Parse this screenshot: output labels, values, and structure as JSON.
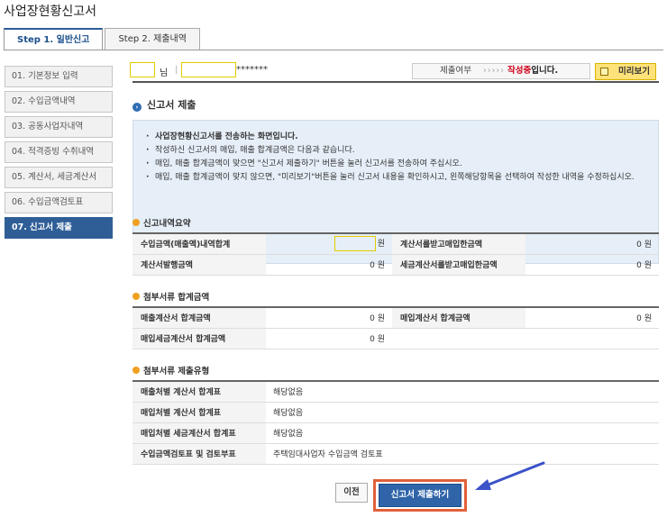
{
  "page": {
    "title": "사업장현황신고서"
  },
  "tabs": [
    {
      "label": "Step 1. 일반신고"
    },
    {
      "label": "Step 2. 제출내역"
    }
  ],
  "sidebar": {
    "items": [
      {
        "num": "01.",
        "label": "기본정보 입력"
      },
      {
        "num": "02.",
        "label": "수입금액내역"
      },
      {
        "num": "03.",
        "label": "공동사업자내역"
      },
      {
        "num": "04.",
        "label": "적격증빙 수취내역"
      },
      {
        "num": "05.",
        "label": "계산서, 세금계산서"
      },
      {
        "num": "06.",
        "label": "수입금액검토표"
      },
      {
        "num": "07.",
        "label": "신고서 제출"
      }
    ]
  },
  "topbar": {
    "name_suffix": "님",
    "separator": "|",
    "id_mask": "*******",
    "status_label": "제출여부",
    "status_arrows": "›››››",
    "status_value": "작성중",
    "status_end": "입니다.",
    "preview_label": "미리보기"
  },
  "section": {
    "title": "신고서 제출",
    "bullet": "›"
  },
  "notice": {
    "lines": [
      "사업장현황신고서를 전송하는 화면입니다.",
      "작성하신 신고서의 매입, 매출 합계금액은 다음과 같습니다.",
      "매입, 매출 합계금액이 맞으면 \"신고서 제출하기\" 버튼을 눌러 신고서를 전송하여 주십시오.",
      "매입, 매출 합계금액이 맞지 않으면, \"미리보기\"버튼을 눌러 신고서 내용을 확인하시고, 왼쪽해당항목을 선택하여 작성한 내역을 수정하십시오."
    ]
  },
  "summary": {
    "title": "신고내역요약",
    "rows": [
      {
        "l1": "수입금액(매출액)내역합계",
        "v1": "원",
        "l2": "계산서를받고매입한금액",
        "v2": "0 원"
      },
      {
        "l1": "계산서발행금액",
        "v1": "0 원",
        "l2": "세금계산서를받고매입한금액",
        "v2": "0 원"
      }
    ]
  },
  "attach_amount": {
    "title": "첨부서류 합계금액",
    "rows": [
      {
        "l1": "매출계산서 합계금액",
        "v1": "0 원",
        "l2": "매입계산서  합계금액",
        "v2": "0 원"
      },
      {
        "l1": "매입세금계산서 합계금액",
        "v1": "0 원",
        "l2": "",
        "v2": ""
      }
    ]
  },
  "attach_type": {
    "title": "첨부서류 제출유형",
    "rows": [
      {
        "label": "매출처별 계산서 합계표",
        "value": "해당없음"
      },
      {
        "label": "매입처별 계산서 합계표",
        "value": "해당없음"
      },
      {
        "label": "매입처별 세금계산서 합계표",
        "value": "해당없음"
      },
      {
        "label": "수입금액검토표 및 검토부표",
        "value": "주택임대사업자 수입금액 검토표"
      }
    ]
  },
  "buttons": {
    "prev": "이전",
    "submit": "신고서 제출하기"
  },
  "colors": {
    "accent": "#2f5e97",
    "highlight_border": "#e3cc00",
    "status_red": "#d0021b",
    "callout": "#e0603a",
    "arrow": "#3b52c9"
  }
}
